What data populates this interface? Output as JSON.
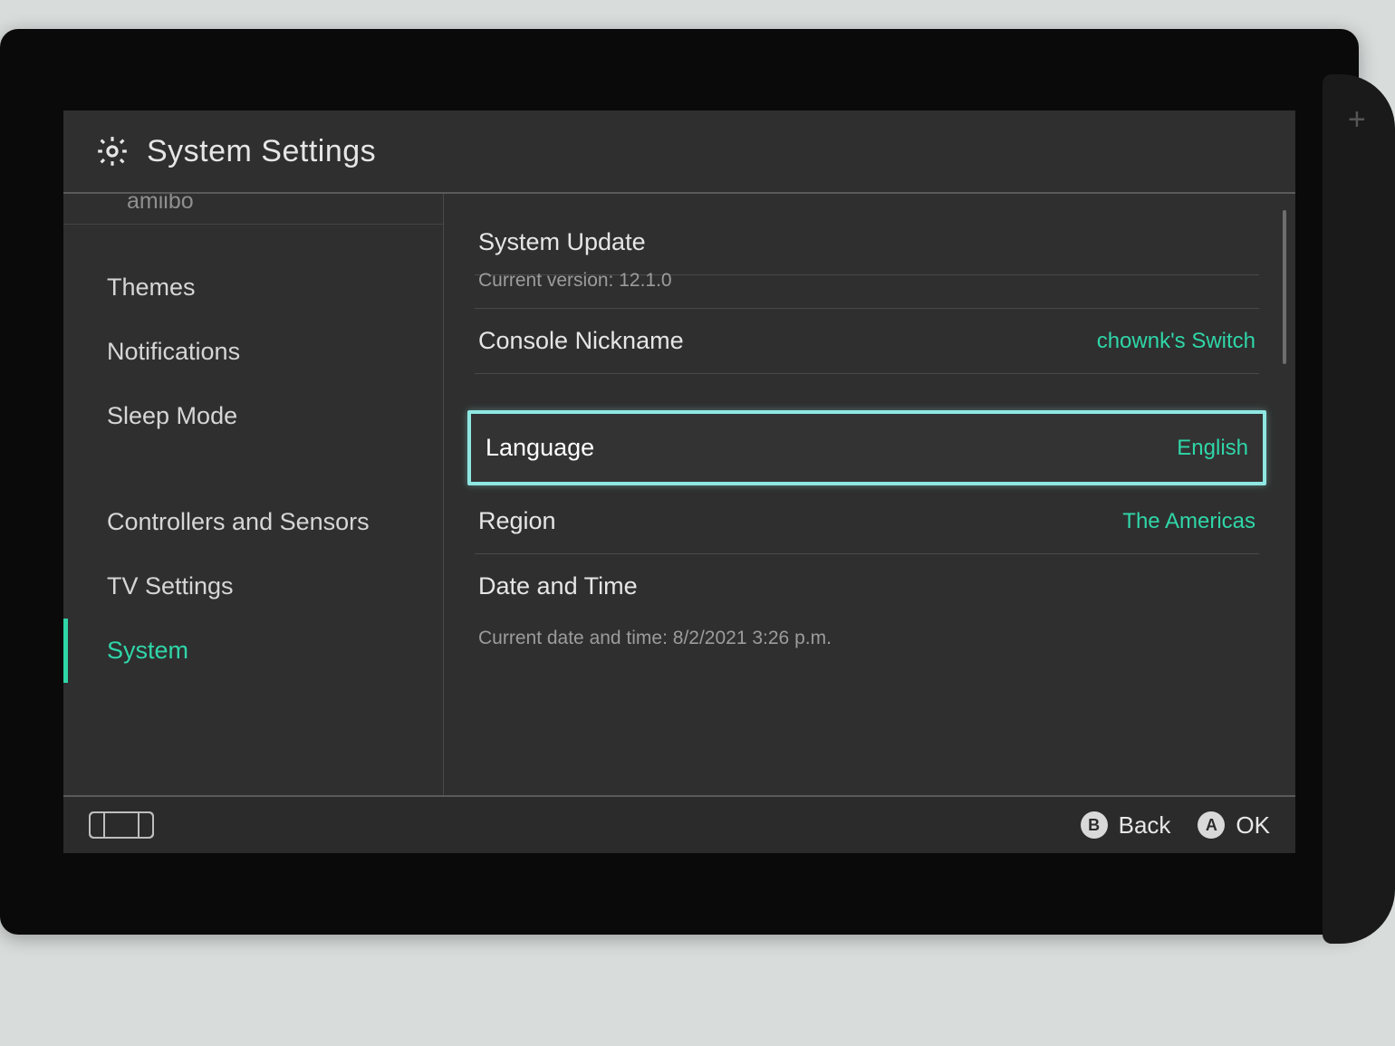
{
  "header": {
    "title": "System Settings"
  },
  "sidebar": {
    "peek_above": "amiibo",
    "items": [
      {
        "label": "Themes"
      },
      {
        "label": "Notifications"
      },
      {
        "label": "Sleep Mode"
      },
      {
        "label": "Controllers and Sensors"
      },
      {
        "label": "TV Settings"
      },
      {
        "label": "System",
        "active": true
      }
    ]
  },
  "content": {
    "system_update": {
      "label": "System Update",
      "sub": "Current version: 12.1.0"
    },
    "console_nickname": {
      "label": "Console Nickname",
      "value": "chownk's Switch"
    },
    "language": {
      "label": "Language",
      "value": "English"
    },
    "region": {
      "label": "Region",
      "value": "The Americas"
    },
    "date_time": {
      "label": "Date and Time",
      "sub": "Current date and time: 8/2/2021 3:26 p.m."
    }
  },
  "footer": {
    "back": {
      "button": "B",
      "label": "Back"
    },
    "ok": {
      "button": "A",
      "label": "OK"
    }
  }
}
